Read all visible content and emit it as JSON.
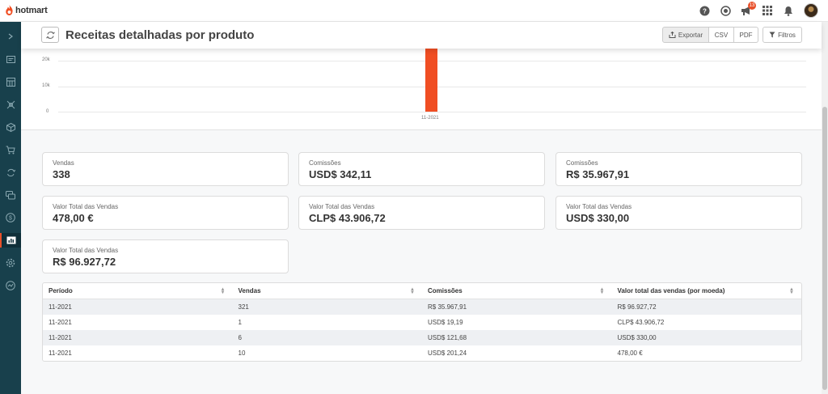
{
  "app": {
    "brand": "hotmart",
    "brand_color": "#f04e23",
    "notification_count": "13"
  },
  "topbar": {
    "icons": [
      "help-icon",
      "support-icon",
      "notifications-megaphone-icon",
      "apps-grid-icon",
      "bell-icon",
      "user-avatar"
    ]
  },
  "sidebar": {
    "icons": [
      "expand-chevron-icon",
      "dashboard-icon",
      "calendar-icon",
      "network-icon",
      "box-icon",
      "cart-icon",
      "refresh-sync-icon",
      "chat-icon",
      "money-icon",
      "reports-icon",
      "settings-icon",
      "marketplace-icon"
    ],
    "active_index": 9
  },
  "header": {
    "title": "Receitas detalhadas por produto",
    "export_label": "Exportar",
    "csv_label": "CSV",
    "pdf_label": "PDF",
    "filters_label": "Filtros"
  },
  "chart_data": {
    "type": "bar",
    "categories": [
      "11-2021"
    ],
    "values": [
      30000
    ],
    "yticks": [
      "20k",
      "10k",
      "0"
    ],
    "ylim": [
      0,
      20000
    ],
    "bar_color": "#f04e23"
  },
  "stats": [
    {
      "label": "Vendas",
      "value": "338"
    },
    {
      "label": "Comissões",
      "value": "USD$ 342,11"
    },
    {
      "label": "Comissões",
      "value": "R$ 35.967,91"
    },
    {
      "label": "Valor Total das Vendas",
      "value": "478,00 €"
    },
    {
      "label": "Valor Total das Vendas",
      "value": "CLP$ 43.906,72"
    },
    {
      "label": "Valor Total das Vendas",
      "value": "USD$ 330,00"
    },
    {
      "label": "Valor Total das Vendas",
      "value": "R$ 96.927,72"
    }
  ],
  "table": {
    "headers": [
      "Período",
      "Vendas",
      "Comissões",
      "Valor total das vendas (por moeda)"
    ],
    "rows": [
      [
        "11-2021",
        "321",
        "R$ 35.967,91",
        "R$ 96.927,72"
      ],
      [
        "11-2021",
        "1",
        "USD$ 19,19",
        "CLP$ 43.906,72"
      ],
      [
        "11-2021",
        "6",
        "USD$ 121,68",
        "USD$ 330,00"
      ],
      [
        "11-2021",
        "10",
        "USD$ 201,24",
        "478,00 €"
      ]
    ]
  }
}
